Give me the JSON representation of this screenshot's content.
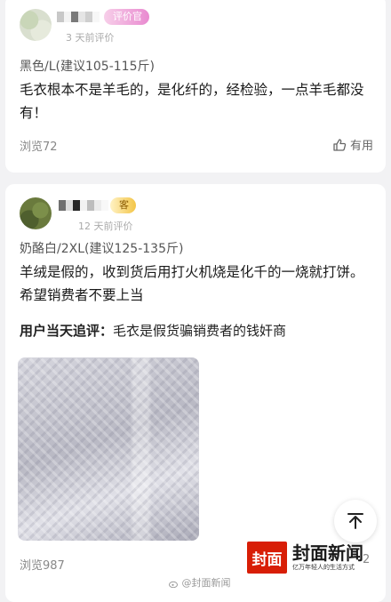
{
  "reviews": [
    {
      "badge": "评价官",
      "time": "3 天前评价",
      "spec": "黑色/L(建议105-115斤)",
      "content": "毛衣根本不是羊毛的，是化纤的，经检验，一点羊毛都没有！",
      "views": "浏览72",
      "helpful": "有用"
    },
    {
      "badge": "客",
      "time": "12 天前评价",
      "spec": "奶酪白/2XL(建议125-135斤)",
      "content": "羊绒是假的，收到货后用打火机烧是化千的一烧就打饼。希望销费者不要上当",
      "followup_label": "用户当天追评：",
      "followup_text": "毛衣是假货骗销费者的钱奸商",
      "views": "浏览987"
    }
  ],
  "logo": {
    "box": "封面",
    "name": "封面新闻",
    "slogan": "亿万年轻人的生活方式"
  },
  "corner_number": "2",
  "watermark": "@封面新闻",
  "icons": [
    "thumbs-up-icon",
    "scroll-to-top-icon",
    "weibo-icon"
  ]
}
